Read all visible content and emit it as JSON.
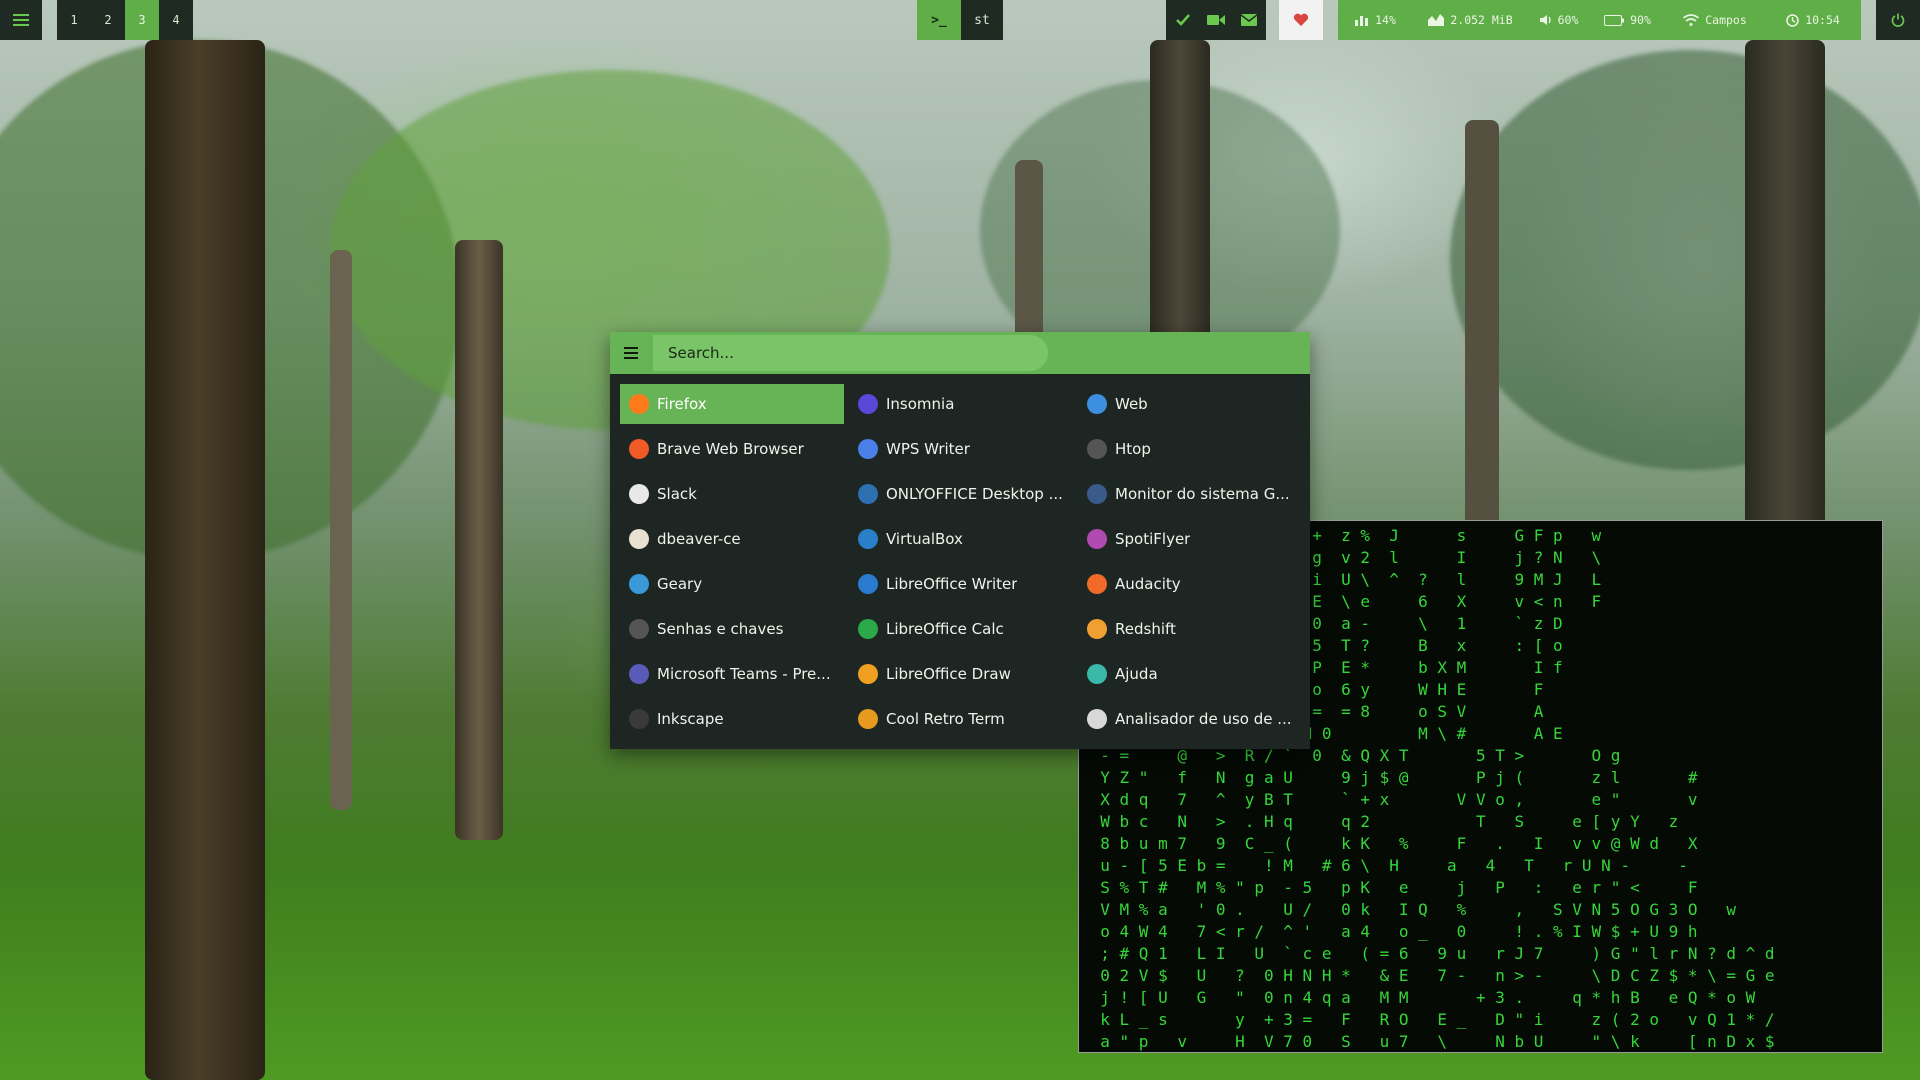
{
  "topbar": {
    "workspaces": [
      "1",
      "2",
      "3",
      "4"
    ],
    "active_workspace": "3",
    "terminal_task": ">_",
    "task_label": "st",
    "status": {
      "cpu": "14%",
      "memory": "2.052 MiB",
      "volume": "60%",
      "battery": "90%",
      "wifi": "Campos",
      "clock": "10:54"
    },
    "icons": [
      "menu-icon",
      "terminal-icon",
      "check-icon",
      "video-icon",
      "mail-icon",
      "heart-icon",
      "chart-icon",
      "memory-icon",
      "volume-icon",
      "battery-icon",
      "wifi-icon",
      "clock-icon",
      "power-icon"
    ]
  },
  "launcher": {
    "search_placeholder": "Search...",
    "apps": [
      {
        "label": "Firefox",
        "icon": "firefox-icon",
        "color": "#ff7a1a",
        "selected": true
      },
      {
        "label": "Insomnia",
        "icon": "insomnia-icon",
        "color": "#5a49d8"
      },
      {
        "label": "Web",
        "icon": "web-icon",
        "color": "#3d8fe0"
      },
      {
        "label": "Brave Web Browser",
        "icon": "brave-icon",
        "color": "#f05a24"
      },
      {
        "label": "WPS Writer",
        "icon": "wps-writer-icon",
        "color": "#4a7fe8"
      },
      {
        "label": "Htop",
        "icon": "htop-icon",
        "color": "#555555"
      },
      {
        "label": "Slack",
        "icon": "slack-icon",
        "color": "#e8e8e8"
      },
      {
        "label": "ONLYOFFICE Desktop ...",
        "icon": "onlyoffice-icon",
        "color": "#2e6fb0"
      },
      {
        "label": "Monitor do sistema G...",
        "icon": "system-monitor-icon",
        "color": "#3a5a8a"
      },
      {
        "label": "dbeaver-ce",
        "icon": "dbeaver-icon",
        "color": "#e8e0d0"
      },
      {
        "label": "VirtualBox",
        "icon": "virtualbox-icon",
        "color": "#2a80c8"
      },
      {
        "label": "SpotiFlyer",
        "icon": "spotiflyer-icon",
        "color": "#b04ab0"
      },
      {
        "label": "Geary",
        "icon": "geary-icon",
        "color": "#3a9ad8"
      },
      {
        "label": "LibreOffice Writer",
        "icon": "libreoffice-writer-icon",
        "color": "#2a7ad0"
      },
      {
        "label": "Audacity",
        "icon": "audacity-icon",
        "color": "#f06a2a"
      },
      {
        "label": "Senhas e chaves",
        "icon": "passwords-icon",
        "color": "#555555"
      },
      {
        "label": "LibreOffice Calc",
        "icon": "libreoffice-calc-icon",
        "color": "#2aa84a"
      },
      {
        "label": "Redshift",
        "icon": "redshift-icon",
        "color": "#f0a030"
      },
      {
        "label": "Microsoft Teams - Pre...",
        "icon": "teams-icon",
        "color": "#5a5ab8"
      },
      {
        "label": "LibreOffice Draw",
        "icon": "libreoffice-draw-icon",
        "color": "#f0a020"
      },
      {
        "label": "Ajuda",
        "icon": "help-icon",
        "color": "#3ab8a8"
      },
      {
        "label": "Inkscape",
        "icon": "inkscape-icon",
        "color": "#3a3a3a"
      },
      {
        "label": "Cool Retro Term",
        "icon": "cool-retro-term-icon",
        "color": "#e89a20"
      },
      {
        "label": "Analisador de uso de ...",
        "icon": "disk-usage-icon",
        "color": "#d8d8d8"
      }
    ]
  },
  "terminal": {
    "lines": [
      "        6    z  ]     8 +  z %  J      s     G F p   w",
      "        q    p  >     ? g  v 2  l      I     j ? N   \\",
      "        o    0  9     % i  U \\  ^  ?   l     9 M J   L",
      "        !    , % p W  + E  \\ e     6   X     v < n   F",
      "        j    X ' h 2  G 0  a -     \\   1     ` z D",
      "        m    k 2 c 3  Y 5  T ?     B   x     : [ o",
      "        l      a \\ V  - P  E *     b X M       I f",
      "        R      F I #  ; o  6 y     W H E       F",
      "        M T    6   d  R =  = 8     o S V       A",
      "        v = <  `   I ] N 0         M \\ #       A E",
      "  - =     @   >  R / `  0  & Q X T       5 T >       O g",
      "  Y Z \"   f   N  g a U     9 j $ @       P j (       z l       #",
      "  X d q   7   ^  y B T     ` + x       V V o ,       e \"       v",
      "  W b c   N   >  . H q     q 2           T   S     e [ y Y   z",
      "  8 b u m 7   9  C _ (     k K   %     F   .   I   v v @ W d   X",
      "  u - [ 5 E b =    ! M   # 6 \\  H     a   4   T   r U N -     -",
      "  S % T #   M % \" p  - 5   p K   e     j   P   :   e r \" <     F",
      "  V M % a   ' 0 .    U /   0 k   I Q   %     ,   S V N 5 O G 3 O   w",
      "  o 4 W 4   7 < r /  ^ '   a 4   o _   0     ! . % I W $ + U 9 h",
      "  ; # Q 1   L I   U  ` c e   ( = 6   9 u   r J 7     ) G \" l r N ? d ^ d",
      "  0 2 V $   U   ?  0 H N H *   & E   7 -   n > -     \\ D C Z $ * \\ = G e",
      "  j ! [ U   G   \"  0 n 4 q a   M M       + 3 .     q * h B   e Q * o W",
      "  k L _ s       y  + 3 =   F   R O   E _   D \" i     z ( 2 o   v Q 1 * /",
      "  a \" p   v     H  V 7 0   S   u 7   \\     N b U     \" \\ k     [ n D x $"
    ]
  }
}
